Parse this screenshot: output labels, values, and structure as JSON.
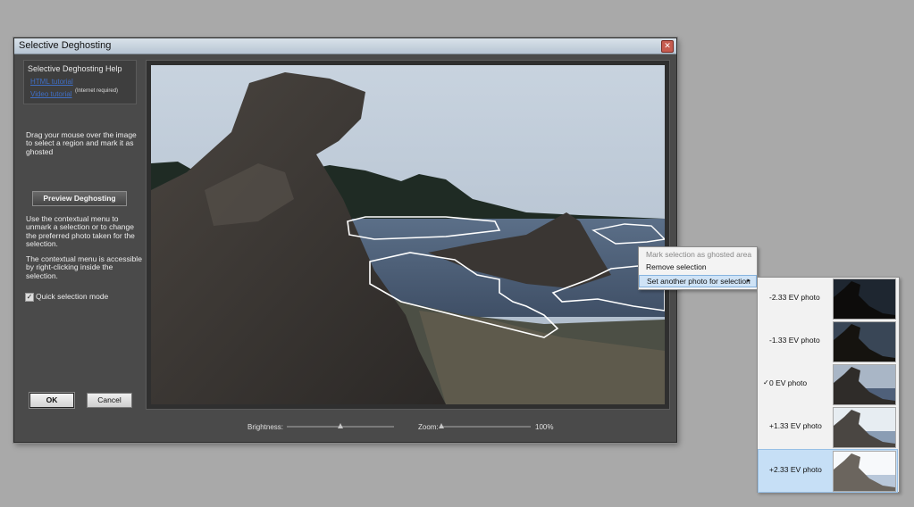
{
  "window": {
    "title": "Selective Deghosting",
    "close_glyph": "✕"
  },
  "help": {
    "title": "Selective Deghosting Help",
    "html_tutorial": "HTML tutorial",
    "video_tutorial": "Video tutorial",
    "internet_note": "(Internet required)"
  },
  "instructions": {
    "drag_text": "Drag your mouse over the image to select a region and mark it as ghosted",
    "context_text": "Use the contextual menu to unmark a selection or to change the preferred photo taken for the selection.",
    "access_text": "The contextual menu is accessible by right-clicking inside the selection."
  },
  "buttons": {
    "preview": "Preview Deghosting",
    "ok": "OK",
    "cancel": "Cancel"
  },
  "quick_selection": {
    "label": "Quick selection mode",
    "checked": true
  },
  "controls": {
    "brightness_label": "Brightness:",
    "brightness_level": 0.5,
    "zoom_label": "Zoom:",
    "zoom_level": 0.0,
    "zoom_value": "100%"
  },
  "context_menu": {
    "items": [
      {
        "label": "Mark selection as ghosted area",
        "enabled": false
      },
      {
        "label": "Remove selection",
        "enabled": true
      },
      {
        "label": "Set another photo for selection",
        "enabled": true,
        "submenu": true
      }
    ],
    "arrow_glyph": "▸"
  },
  "photo_submenu": {
    "check_glyph": "✓",
    "items": [
      {
        "label": "-2.33 EV photo",
        "checked": false,
        "highlighted": false
      },
      {
        "label": "-1.33 EV photo",
        "checked": false,
        "highlighted": false
      },
      {
        "label": "0 EV photo",
        "checked": true,
        "highlighted": false
      },
      {
        "label": "+1.33 EV photo",
        "checked": false,
        "highlighted": false
      },
      {
        "label": "+2.33 EV photo",
        "checked": false,
        "highlighted": true
      }
    ]
  }
}
